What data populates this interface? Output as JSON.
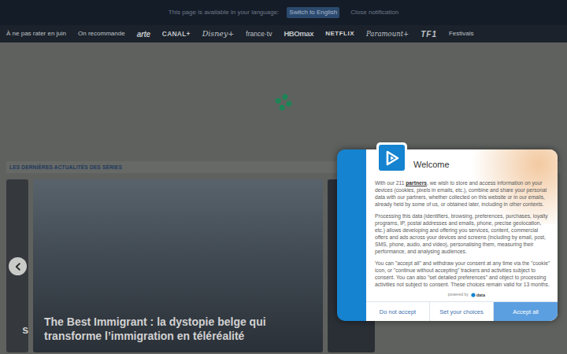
{
  "notification": {
    "message": "This page is available in your language:",
    "switch_button": "Switch to English",
    "close": "Close notification"
  },
  "nav": {
    "items": [
      {
        "label": "À ne pas rater en juin",
        "kind": "link"
      },
      {
        "label": "On recommande",
        "kind": "link"
      },
      {
        "label": "arte",
        "kind": "logo"
      },
      {
        "label": "CANAL+",
        "kind": "logo"
      },
      {
        "label": "Disney+",
        "kind": "logo"
      },
      {
        "label": "france·tv",
        "kind": "logo"
      },
      {
        "label": "HBOmax",
        "kind": "logo"
      },
      {
        "label": "NETFLIX",
        "kind": "logo"
      },
      {
        "label": "Paramount+",
        "kind": "logo"
      },
      {
        "label": "TF1",
        "kind": "logo"
      },
      {
        "label": "Festivals",
        "kind": "link"
      }
    ]
  },
  "section_title": "LES DERNIÈRES ACTUALITÉS DES SÉRIES",
  "carousel": {
    "left_card_fragment": "s",
    "slides": [
      {
        "title": "The Best Immigrant : la dystopie belge qui transforme l’immigration en téléréalité"
      }
    ]
  },
  "consent": {
    "title": "Welcome",
    "intro": {
      "before": "With our 211 ",
      "link": "partners",
      "after": ", we wish to store and access information on your devices (cookies, pixels in emails, etc.), combine and share your personal data with our partners, whether collected on this website or in our emails, already held by some of us, or obtained later, including in other contexts."
    },
    "paragraphs": [
      "Processing this data (identifiers, browsing, preferences, purchases, loyalty programs, IP, postal addresses and emails, phone, precise geolocation, etc.) allows developing and offering you services, content, commercial offers and ads across your devices and screens (including by email, post, SMS, phone, audio, and video), personalising them, measuring their performance, and analysing audiences.",
      "You can \"accept all\" and withdraw your consent at any time via the \"cookie\" icon, or \"continue without accepting\" trackers and activities subject to consent. You can also \"set detailed preferences\" and object to processing activities not subject to consent. These choices remain valid for 13 months."
    ],
    "powered_by": "powered by",
    "powered_logo": "data",
    "buttons": [
      {
        "label": "Do not accept",
        "primary": false
      },
      {
        "label": "Set your choices",
        "primary": false
      },
      {
        "label": "Accept all",
        "primary": true
      }
    ]
  }
}
